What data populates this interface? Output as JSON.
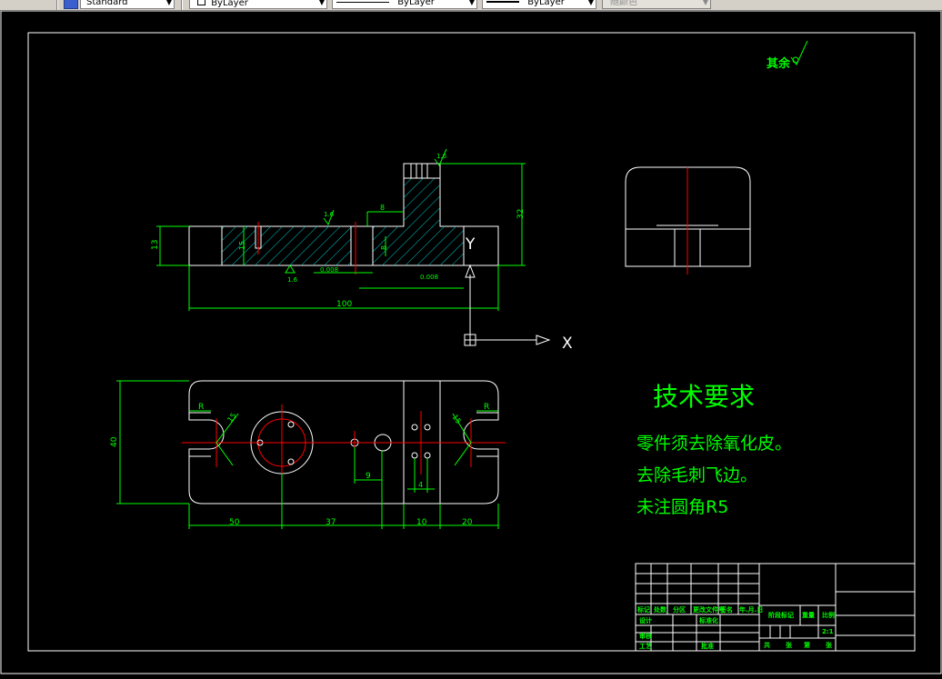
{
  "toolbar": {
    "text_style": "Standard",
    "layer": "ByLayer",
    "linetype": "ByLayer",
    "lineweight": "ByLayer",
    "plot_style": "随颜色"
  },
  "drawing": {
    "roughness_note": "其余",
    "technical_requirements": {
      "title": "技术要求",
      "lines": [
        "零件须去除氧化皮。",
        "去除毛刺飞边。",
        "未注圆角R5"
      ]
    },
    "ucs": {
      "x_label": "X",
      "y_label": "Y"
    },
    "dimensions": {
      "overall_length": "100",
      "base_height": "13",
      "total_height": "32",
      "width_40": "40",
      "plan_50": "50",
      "plan_37": "37",
      "plan_10": "10",
      "plan_20": "20",
      "plan_9": "9",
      "plan_4": "4",
      "r_left": "R",
      "r_right": "R",
      "r_15_left": "15",
      "r_15_right": "15",
      "d_8": "8",
      "d_8_right": "8",
      "front_15": "15",
      "rough_1": "1.6",
      "rough_2": "1.6",
      "rough_3": "1.6",
      "tol_1": "0.008",
      "tol_2": "0.008"
    },
    "title_block": {
      "row_labels": [
        "标记",
        "处数",
        "分区",
        "更改文件号",
        "签名",
        "年.月.日"
      ],
      "designer_label": "设计",
      "standardize_label": "标准化",
      "stage_label": "阶段标记",
      "weight_label": "重量",
      "scale_label": "比例",
      "scale_value": "2:1",
      "review_label": "审核",
      "process_label": "工艺",
      "approve_label": "批准",
      "sheet_labels": [
        "共",
        "张",
        "第",
        "张"
      ]
    }
  }
}
